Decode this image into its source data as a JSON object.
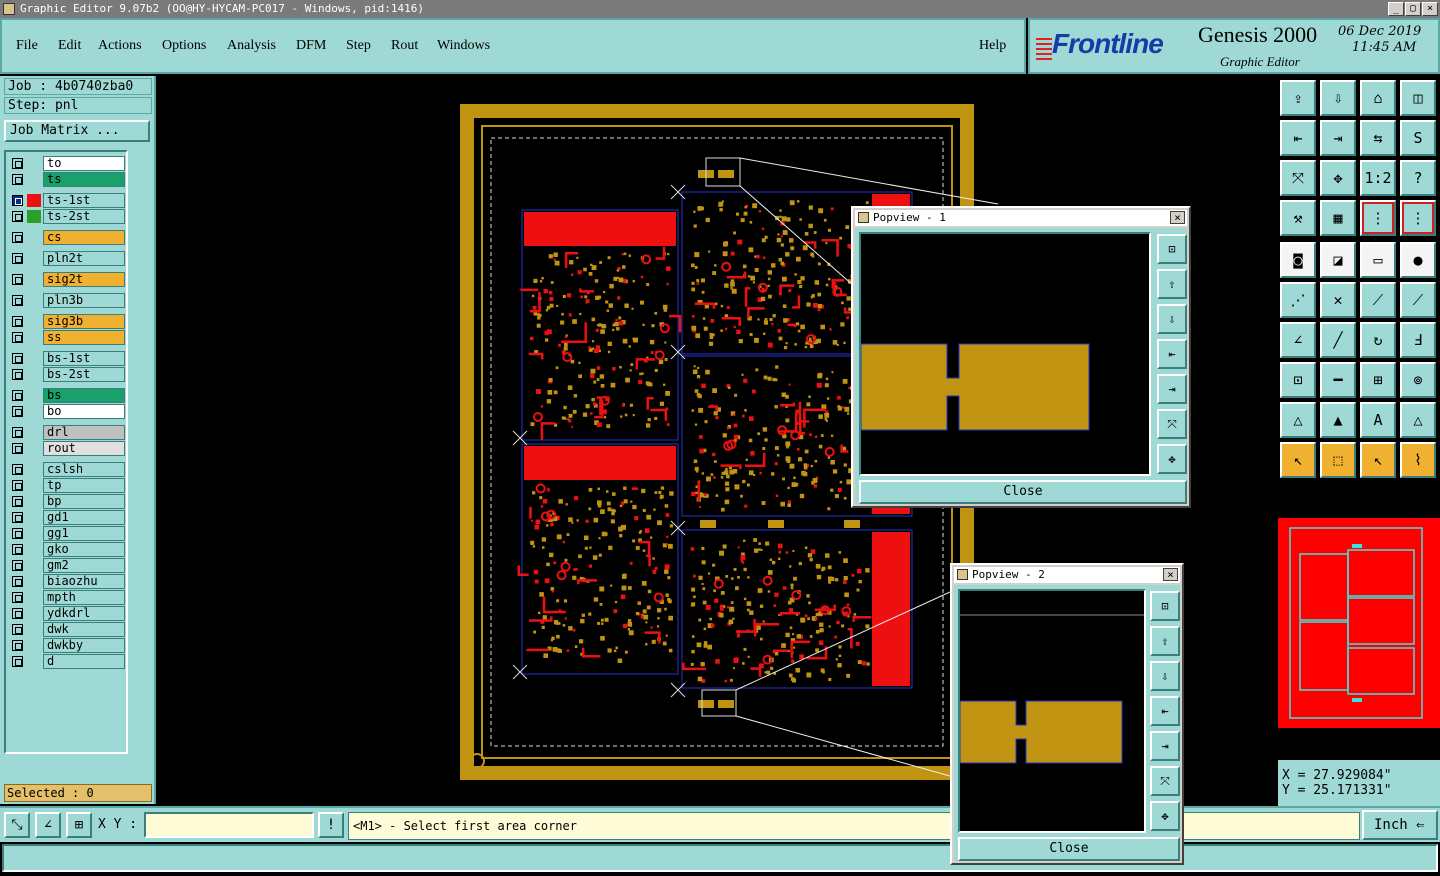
{
  "window": {
    "title": "Graphic Editor 9.07b2 (OO@HY-HYCAM-PC017 - Windows, pid:1416)",
    "minimize": "_",
    "restore": "▢",
    "close": "×"
  },
  "menu": {
    "items": [
      "File",
      "Edit",
      "Actions",
      "Options",
      "Analysis",
      "DFM",
      "Step",
      "Rout",
      "Windows"
    ],
    "help": "Help"
  },
  "brand": {
    "logo": "Frontline",
    "product": "Genesis 2000",
    "subtitle": "Graphic Editor",
    "date": "06 Dec 2019",
    "time": "11:45 AM"
  },
  "job": {
    "job_label": "Job : 4b0740zba0",
    "step_label": "Step: pnl",
    "matrix_button": "Job Matrix ..."
  },
  "layers": [
    {
      "name": "to",
      "color": "#ffffff",
      "swatch": null,
      "checked": false
    },
    {
      "name": "ts",
      "color": "#1aa06a",
      "swatch": null,
      "checked": false
    },
    {
      "name": "ts-1st",
      "color": "#9fd9d6",
      "swatch": "#ee1010",
      "checked": true
    },
    {
      "name": "ts-2st",
      "color": "#9fd9d6",
      "swatch": "#2aa02a",
      "checked": false
    },
    {
      "name": "cs",
      "color": "#f0b030",
      "swatch": null,
      "checked": false
    },
    {
      "name": "pln2t",
      "color": "#9fd9d6",
      "swatch": null,
      "checked": false
    },
    {
      "name": "sig2t",
      "color": "#f0b030",
      "swatch": null,
      "checked": false
    },
    {
      "name": "pln3b",
      "color": "#9fd9d6",
      "swatch": null,
      "checked": false
    },
    {
      "name": "sig3b",
      "color": "#f0b030",
      "swatch": null,
      "checked": false
    },
    {
      "name": "ss",
      "color": "#f0b030",
      "swatch": null,
      "checked": false
    },
    {
      "name": "bs-1st",
      "color": "#9fd9d6",
      "swatch": null,
      "checked": false
    },
    {
      "name": "bs-2st",
      "color": "#9fd9d6",
      "swatch": null,
      "checked": false
    },
    {
      "name": "bs",
      "color": "#1aa06a",
      "swatch": null,
      "checked": false
    },
    {
      "name": "bo",
      "color": "#ffffff",
      "swatch": null,
      "checked": false
    },
    {
      "name": "drl",
      "color": "#c0c0c0",
      "swatch": null,
      "checked": false
    },
    {
      "name": "rout",
      "color": "#e0e0e0",
      "swatch": null,
      "checked": false
    },
    {
      "name": "cslsh",
      "color": "#9fd9d6",
      "swatch": null,
      "checked": false
    },
    {
      "name": "tp",
      "color": "#9fd9d6",
      "swatch": null,
      "checked": false
    },
    {
      "name": "bp",
      "color": "#9fd9d6",
      "swatch": null,
      "checked": false
    },
    {
      "name": "gd1",
      "color": "#9fd9d6",
      "swatch": null,
      "checked": false
    },
    {
      "name": "gg1",
      "color": "#9fd9d6",
      "swatch": null,
      "checked": false
    },
    {
      "name": "gko",
      "color": "#9fd9d6",
      "swatch": null,
      "checked": false
    },
    {
      "name": "gm2",
      "color": "#9fd9d6",
      "swatch": null,
      "checked": false
    },
    {
      "name": "biaozhu",
      "color": "#9fd9d6",
      "swatch": null,
      "checked": false
    },
    {
      "name": "mpth",
      "color": "#9fd9d6",
      "swatch": null,
      "checked": false
    },
    {
      "name": "ydkdrl",
      "color": "#9fd9d6",
      "swatch": null,
      "checked": false
    },
    {
      "name": "dwk",
      "color": "#9fd9d6",
      "swatch": null,
      "checked": false
    },
    {
      "name": "dwkby",
      "color": "#9fd9d6",
      "swatch": null,
      "checked": false
    },
    {
      "name": "d",
      "color": "#9fd9d6",
      "swatch": null,
      "checked": false
    }
  ],
  "selected": "Selected : 0",
  "tools": [
    {
      "icon": "export-icon",
      "glyph": "⇪",
      "style": "teal"
    },
    {
      "icon": "import-icon",
      "glyph": "⇩",
      "style": "teal"
    },
    {
      "icon": "home-icon",
      "glyph": "⌂",
      "style": "teal"
    },
    {
      "icon": "split-view-icon",
      "glyph": "◫",
      "style": "teal"
    },
    {
      "icon": "pan-left-icon",
      "glyph": "⇤",
      "style": "teal"
    },
    {
      "icon": "pan-right-icon",
      "glyph": "⇥",
      "style": "teal"
    },
    {
      "icon": "swap-icon",
      "glyph": "⇆",
      "style": "teal"
    },
    {
      "icon": "redraw-icon",
      "glyph": "S",
      "style": "teal"
    },
    {
      "icon": "zoom-fit-icon",
      "glyph": "⤧",
      "style": "teal"
    },
    {
      "icon": "zoom-center-icon",
      "glyph": "✥",
      "style": "teal"
    },
    {
      "icon": "scale-icon",
      "glyph": "1:2",
      "style": "teal"
    },
    {
      "icon": "help-icon",
      "glyph": "?",
      "style": "teal"
    },
    {
      "icon": "wrench-icon",
      "glyph": "⚒",
      "style": "teal"
    },
    {
      "icon": "grid-icon",
      "glyph": "▦",
      "style": "teal"
    },
    {
      "icon": "layers-icon",
      "glyph": "⋮",
      "style": "red-outline"
    },
    {
      "icon": "layers-alt-icon",
      "glyph": "⋮",
      "style": "red-outline"
    },
    {
      "icon": "select-pad-icon",
      "glyph": "◙",
      "style": "white"
    },
    {
      "icon": "color-icon",
      "glyph": "◪",
      "style": "white"
    },
    {
      "icon": "ruler-icon",
      "glyph": "▭",
      "style": "white"
    },
    {
      "icon": "dot-icon",
      "glyph": "●",
      "style": "white"
    },
    {
      "icon": "connect-icon",
      "glyph": "⋰",
      "style": "teal"
    },
    {
      "icon": "cross-icon",
      "glyph": "✕",
      "style": "teal"
    },
    {
      "icon": "line-pad-icon",
      "glyph": "⟋",
      "style": "teal"
    },
    {
      "icon": "line-dot-icon",
      "glyph": "⟋",
      "style": "teal"
    },
    {
      "icon": "angle-icon",
      "glyph": "∠",
      "style": "teal"
    },
    {
      "icon": "line-icon",
      "glyph": "╱",
      "style": "teal"
    },
    {
      "icon": "arc-icon",
      "glyph": "↻",
      "style": "teal"
    },
    {
      "icon": "text-icon",
      "glyph": "Ⅎ",
      "style": "teal"
    },
    {
      "icon": "pad-move-icon",
      "glyph": "⊡",
      "style": "teal"
    },
    {
      "icon": "dash-icon",
      "glyph": "━",
      "style": "teal"
    },
    {
      "icon": "measure-icon",
      "glyph": "⊞",
      "style": "teal"
    },
    {
      "icon": "circles-icon",
      "glyph": "⊚",
      "style": "teal"
    },
    {
      "icon": "triangle-icon",
      "glyph": "△",
      "style": "teal"
    },
    {
      "icon": "triangle-cut-icon",
      "glyph": "▲",
      "style": "teal"
    },
    {
      "icon": "triangle-a-icon",
      "glyph": "A",
      "style": "teal"
    },
    {
      "icon": "triangle-b-icon",
      "glyph": "△",
      "style": "teal"
    },
    {
      "icon": "pointer-icon",
      "glyph": "↖",
      "style": "orange"
    },
    {
      "icon": "pointer-box-icon",
      "glyph": "⬚",
      "style": "orange"
    },
    {
      "icon": "pointer-select-icon",
      "glyph": "↖",
      "style": "orange"
    },
    {
      "icon": "route-icon",
      "glyph": "⌇",
      "style": "orange"
    }
  ],
  "coords": {
    "x": "X = 27.929084\"",
    "y": "Y = 25.171331\""
  },
  "status": {
    "xy_label": "X Y :",
    "xy_value": "",
    "alert": "!",
    "prompt": "<M1> - Select first area corner",
    "units": "Inch",
    "units_arrow": "⇐"
  },
  "popview1": {
    "title": "Popview - 1",
    "close": "Close",
    "close_x": "×"
  },
  "popview2": {
    "title": "Popview - 2",
    "close": "Close",
    "close_x": "×"
  },
  "colors": {
    "copper": "#c09410",
    "pads": "#ee1010",
    "profile": "#2233cc",
    "panel": "#9fd9d6",
    "overview": "#ff0000",
    "outline": "#40e0e0"
  }
}
